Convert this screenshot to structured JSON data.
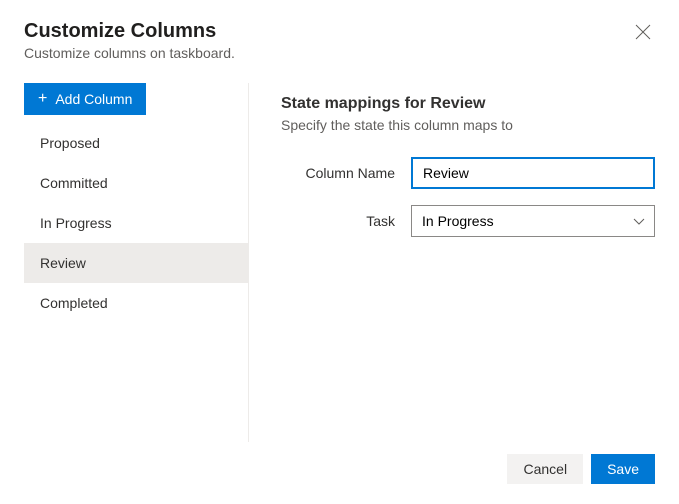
{
  "header": {
    "title": "Customize Columns",
    "subtitle": "Customize columns on taskboard."
  },
  "sidebar": {
    "add_label": "Add Column",
    "items": [
      {
        "label": "Proposed",
        "selected": false
      },
      {
        "label": "Committed",
        "selected": false
      },
      {
        "label": "In Progress",
        "selected": false
      },
      {
        "label": "Review",
        "selected": true
      },
      {
        "label": "Completed",
        "selected": false
      }
    ]
  },
  "main": {
    "section_title": "State mappings for Review",
    "section_sub": "Specify the state this column maps to",
    "fields": {
      "column_name_label": "Column Name",
      "column_name_value": "Review",
      "task_label": "Task",
      "task_value": "In Progress"
    }
  },
  "footer": {
    "cancel_label": "Cancel",
    "save_label": "Save"
  }
}
